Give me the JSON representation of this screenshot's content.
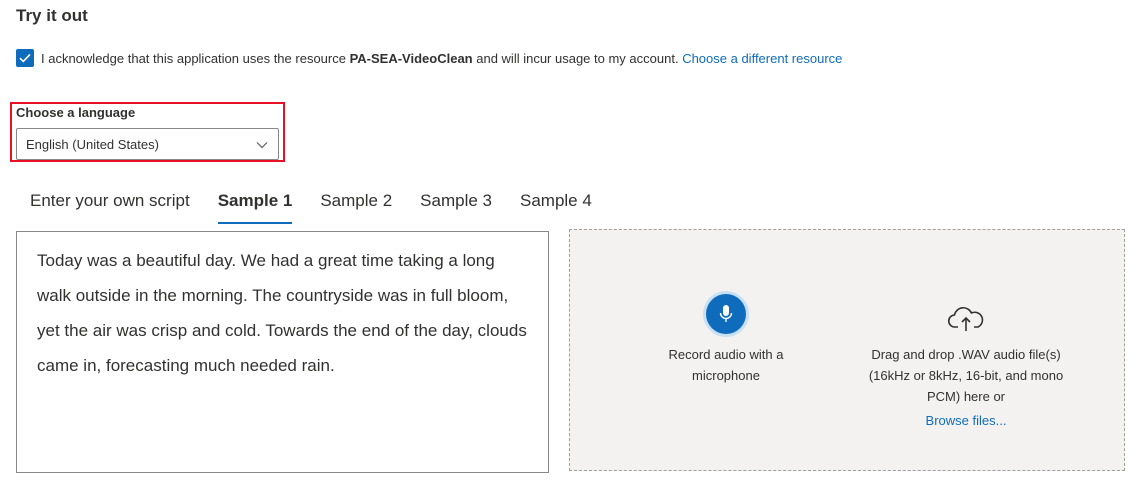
{
  "section": {
    "title": "Try it out"
  },
  "acknowledge": {
    "checked": true,
    "text_before": "I acknowledge that this application uses the resource ",
    "resource_name": "PA-SEA-VideoClean",
    "text_after": " and will incur usage to my account. ",
    "link": "Choose a different resource"
  },
  "language": {
    "label": "Choose a language",
    "selected": "English (United States)"
  },
  "tabs": [
    {
      "label": "Enter your own script",
      "active": false
    },
    {
      "label": "Sample 1",
      "active": true
    },
    {
      "label": "Sample 2",
      "active": false
    },
    {
      "label": "Sample 3",
      "active": false
    },
    {
      "label": "Sample 4",
      "active": false
    }
  ],
  "script": {
    "text": "Today was a beautiful day. We had a great time taking a long walk outside in the morning. The countryside was in full bloom, yet the air was crisp and cold. Towards the end of the day, clouds came in, forecasting much needed rain."
  },
  "record": {
    "icon": "microphone-icon",
    "label": "Record audio with a microphone"
  },
  "upload": {
    "icon": "cloud-upload-icon",
    "label": "Drag and drop .WAV audio file(s) (16kHz or 8kHz, 16-bit, and mono PCM) here or",
    "link": "Browse files..."
  },
  "colors": {
    "accent": "#0f6cbd",
    "highlight_border": "#e81123",
    "drop_zone_bg": "#f3f2f1"
  }
}
